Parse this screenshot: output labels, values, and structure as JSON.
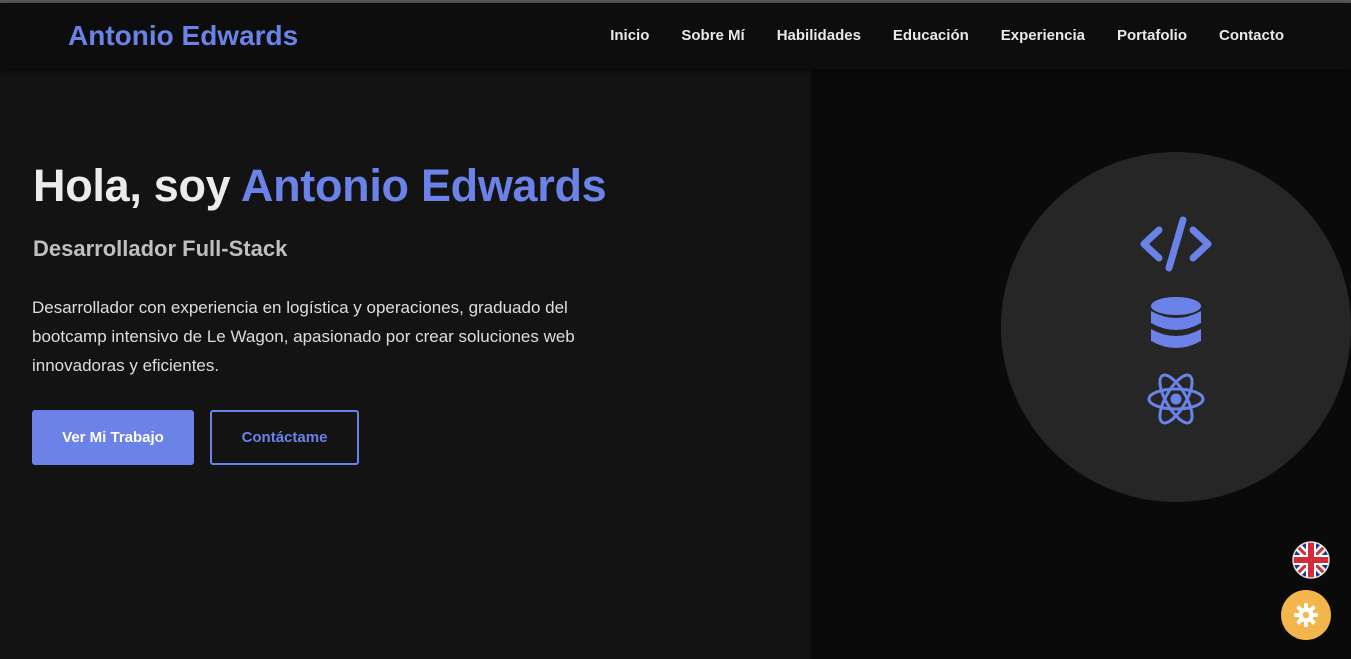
{
  "header": {
    "brand": "Antonio Edwards",
    "nav": [
      {
        "label": "Inicio"
      },
      {
        "label": "Sobre Mí"
      },
      {
        "label": "Habilidades"
      },
      {
        "label": "Educación"
      },
      {
        "label": "Experiencia"
      },
      {
        "label": "Portafolio"
      },
      {
        "label": "Contacto"
      }
    ]
  },
  "hero": {
    "greeting": "Hola, soy ",
    "name": "Antonio Edwards",
    "role": "Desarrollador Full-Stack",
    "description": "Desarrollador con experiencia en logística y operaciones, graduado del bootcamp intensivo de Le Wagon, apasionado por crear soluciones web innovadoras y eficientes.",
    "primary_button": "Ver Mi Trabajo",
    "secondary_button": "Contáctame"
  },
  "visual": {
    "icons": [
      "code-icon",
      "database-icon",
      "react-atom-icon"
    ]
  },
  "floating": {
    "language_icon": "uk-flag-icon",
    "theme_icon": "sun-gear-icon"
  },
  "colors": {
    "accent": "#6b82e8",
    "background": "#121212",
    "theme_button": "#f3b64c"
  }
}
